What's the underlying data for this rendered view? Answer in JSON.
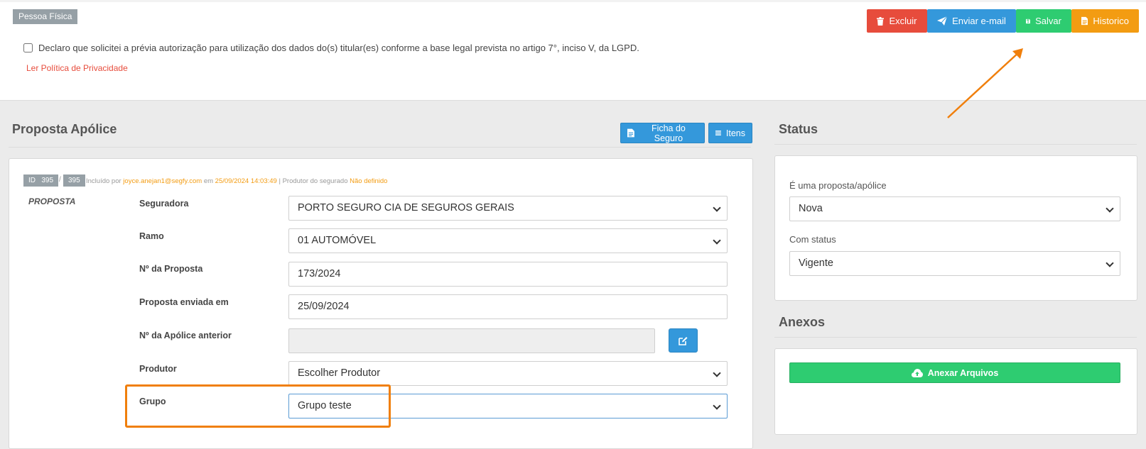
{
  "header": {
    "person_type": "Pessoa Física",
    "lgpd_text": "Declaro que solicitei a prévia autorização para utilização dos dados do(s) titular(es) conforme a base legal prevista no artigo 7°, inciso V, da LGPD.",
    "privacy_link": "Ler Política de Privacidade",
    "lgpd_checked": false,
    "actions": {
      "delete": "Excluir",
      "email": "Enviar e-mail",
      "save": "Salvar",
      "history": "Historico"
    }
  },
  "proposal": {
    "title": "Proposta Apólice",
    "ficha_button": "Ficha do Seguro",
    "itens_button": "Itens",
    "id_label": "ID",
    "id_value": "395",
    "id_sep": "/",
    "id_value2": "395",
    "meta_prefix": "Incluído por",
    "meta_user": "joyce.anejan1@segfy.com",
    "meta_em": "em",
    "meta_date": "25/09/2024 14:03:49",
    "meta_mid": "| Produtor do segurado",
    "meta_producer": "Não definido",
    "section_label": "PROPOSTA",
    "fields": {
      "seguradora_label": "Seguradora",
      "seguradora_value": "PORTO SEGURO CIA DE SEGUROS GERAIS",
      "ramo_label": "Ramo",
      "ramo_value": "01 AUTOMÓVEL",
      "numero_label": "Nº da Proposta",
      "numero_value": "173/2024",
      "enviada_label": "Proposta enviada em",
      "enviada_value": "25/09/2024",
      "apolice_anterior_label": "Nº da Apólice anterior",
      "apolice_anterior_value": "",
      "produtor_label": "Produtor",
      "produtor_value": "Escolher Produtor",
      "grupo_label": "Grupo",
      "grupo_value": "Grupo teste"
    }
  },
  "status": {
    "title": "Status",
    "type_label": "É uma proposta/apólice",
    "type_value": "Nova",
    "status_label": "Com status",
    "status_value": "Vigente"
  },
  "attachments": {
    "title": "Anexos",
    "button": "Anexar Arquivos"
  },
  "colors": {
    "danger": "#e74c3c",
    "primary": "#3498db",
    "success": "#2ecc71",
    "warning": "#f39c12",
    "annotation": "#f07f0c"
  }
}
